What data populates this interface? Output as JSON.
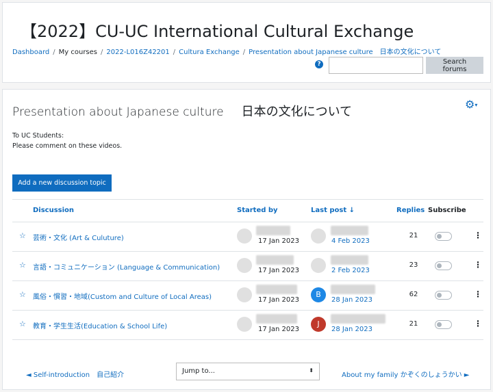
{
  "header": {
    "course_title": "【2022】CU-UC International Cultural Exchange",
    "breadcrumb": [
      "Dashboard",
      "My courses",
      "2022-L016Z42201",
      "Cultura Exchange",
      "Presentation about Japanese culture　日本の文化について"
    ],
    "search_placeholder": "",
    "search_button": "Search forums",
    "help_icon": "?"
  },
  "forum": {
    "title": "Presentation about Japanese culture",
    "title_jp": "日本の文化について",
    "intro_line1": "To UC Students:",
    "intro_line2": "Please comment on these videos.",
    "add_button": "Add a new discussion topic"
  },
  "table": {
    "headers": {
      "discussion": "Discussion",
      "started_by": "Started by",
      "last_post": "Last post ↓",
      "replies": "Replies",
      "subscribe": "Subscribe"
    },
    "rows": [
      {
        "title": "芸術・文化 (Art & Culuture)",
        "started": "17 Jan 2023",
        "last": "4 Feb 2023",
        "avatar_letter": "",
        "avatar_color": "#e0e0e0",
        "replies": "21"
      },
      {
        "title": "言語・コミュニケーション (Language & Communication)",
        "started": "17 Jan 2023",
        "last": "2 Feb 2023",
        "avatar_letter": "",
        "avatar_color": "#e0e0e0",
        "replies": "23"
      },
      {
        "title": "風俗・慣習・地域(Custom and Culture of Local Areas)",
        "started": "17 Jan 2023",
        "last": "28 Jan 2023",
        "avatar_letter": "B",
        "avatar_color": "#1e88e5",
        "replies": "62"
      },
      {
        "title": "教育・学生生活(Education & School Life)",
        "started": "17 Jan 2023",
        "last": "28 Jan 2023",
        "avatar_letter": "J",
        "avatar_color": "#c0392b",
        "replies": "21"
      }
    ]
  },
  "footer": {
    "prev": "◄ Self-introduction　自己紹介",
    "jump": "Jump to...",
    "next": "About my family かぞくのしょうかい ►"
  },
  "colors": {
    "link": "#0f6cbf",
    "button": "#0f6cbf"
  },
  "icons": {
    "star": "star-icon",
    "gear": "gear-icon",
    "kebab": "kebab-menu-icon"
  }
}
